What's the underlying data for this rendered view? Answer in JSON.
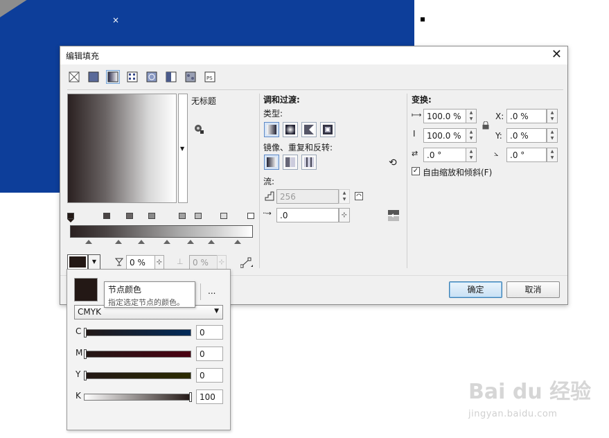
{
  "dialog": {
    "title": "编辑填充",
    "preset_name": "无标题",
    "ok_label": "确定",
    "cancel_label": "取消"
  },
  "blend": {
    "heading": "调和过渡:",
    "type_label": "类型:",
    "mirror_label": "镜像、重复和反转:",
    "flow_label": "流:",
    "steps_value": "256",
    "accel_value": ".0"
  },
  "transform": {
    "heading": "变换:",
    "width_value": "100.0 %",
    "height_value": "100.0 %",
    "x_label": "X:",
    "x_value": ".0 %",
    "y_label": "Y:",
    "y_value": ".0 %",
    "skew_value": ".0 °",
    "rotate_value": ".0 °",
    "free_scale_label": "自由缩放和倾斜(F)",
    "free_scale_checked": true
  },
  "node_bar": {
    "transparency_value": "0 %",
    "position_value": "0 %"
  },
  "color_popup": {
    "more_label": "...",
    "model": "CMYK",
    "channels": [
      {
        "label": "C",
        "value": "0"
      },
      {
        "label": "M",
        "value": "0"
      },
      {
        "label": "Y",
        "value": "0"
      },
      {
        "label": "K",
        "value": "100"
      }
    ]
  },
  "tooltip": {
    "title": "节点颜色",
    "body": "指定选定节点的颜色。"
  },
  "watermark": {
    "main": "Bai du 经验",
    "sub": "jingyan.baidu.com"
  },
  "colors": {
    "canvas_blue": "#0d3e9a",
    "node_color": "#231815",
    "ok_border": "#3c7fb1"
  }
}
